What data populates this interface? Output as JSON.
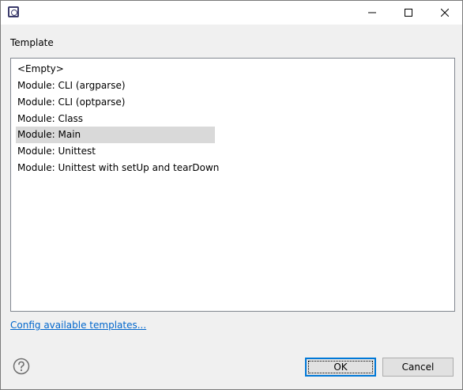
{
  "window": {
    "icons": {
      "app": "app-icon",
      "minimize": "minimize-icon",
      "maximize": "maximize-icon",
      "close": "close-icon"
    }
  },
  "template_section": {
    "label": "Template",
    "items": [
      {
        "label": "<Empty>",
        "selected": false
      },
      {
        "label": "Module: CLI (argparse)",
        "selected": false
      },
      {
        "label": "Module: CLI (optparse)",
        "selected": false
      },
      {
        "label": "Module: Class",
        "selected": false
      },
      {
        "label": "Module: Main",
        "selected": true
      },
      {
        "label": "Module: Unittest",
        "selected": false
      },
      {
        "label": "Module: Unittest with setUp and tearDown",
        "selected": false
      }
    ]
  },
  "config_link": "Config available templates...",
  "footer": {
    "help_icon": "help-icon",
    "ok_label": "OK",
    "cancel_label": "Cancel"
  },
  "colors": {
    "selection": "#d9d9d9",
    "link": "#0066cc",
    "focus_border": "#0078d7"
  }
}
